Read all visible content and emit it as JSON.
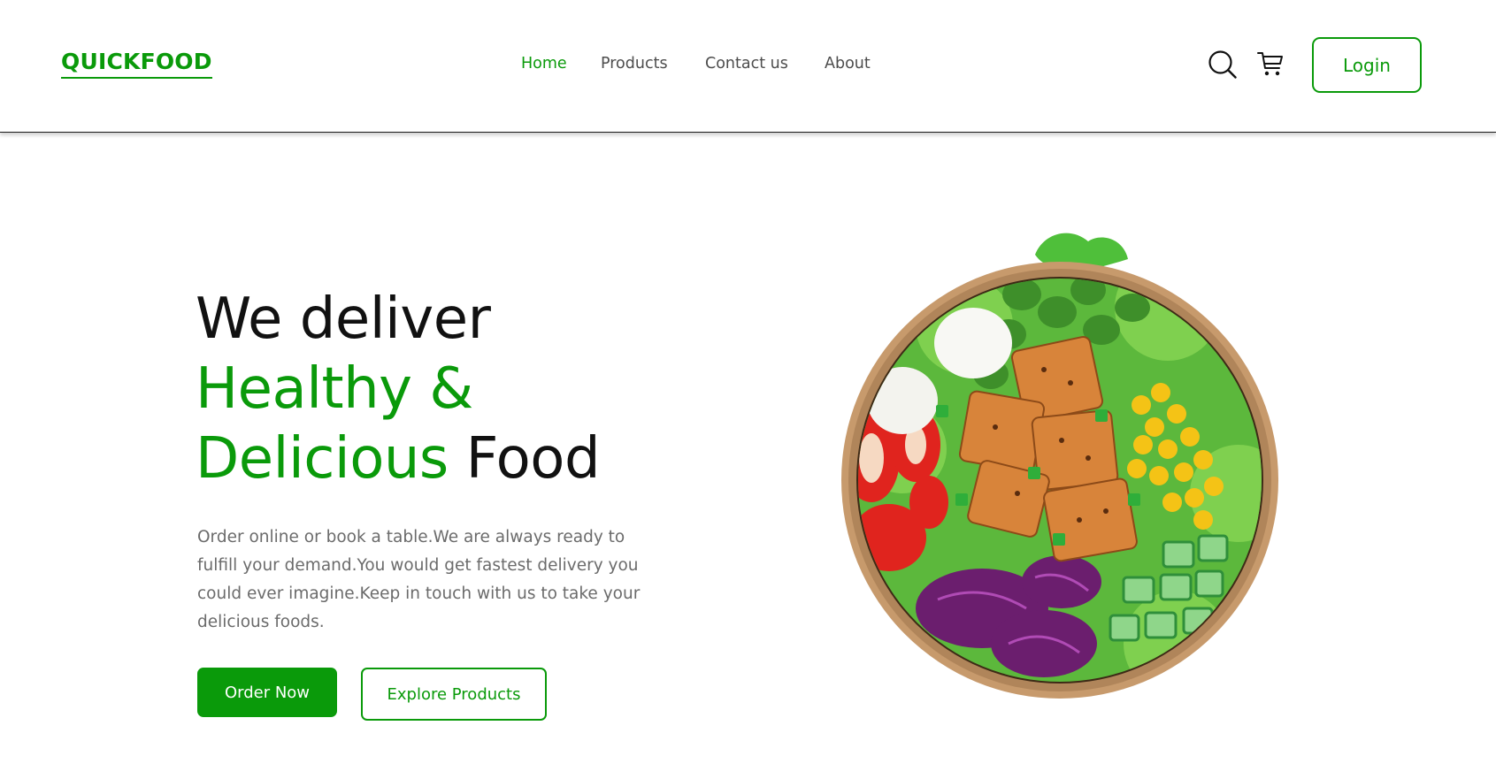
{
  "header": {
    "logo": "QUICKFOOD",
    "nav": [
      {
        "label": "Home",
        "active": true
      },
      {
        "label": "Products",
        "active": false
      },
      {
        "label": "Contact us",
        "active": false
      },
      {
        "label": "About",
        "active": false
      }
    ],
    "icons": [
      "search-icon",
      "cart-icon"
    ],
    "login_label": "Login"
  },
  "hero": {
    "title_line1": "We deliver",
    "title_line2": "Healthy &",
    "title_line3_green": "Delicious",
    "title_line3_rest": " Food",
    "description": "Order online or book a table.We are always ready to fulfill your demand.You would get fastest delivery you could ever imagine.Keep in touch with us to take your delicious foods.",
    "order_label": "Order Now",
    "explore_label": "Explore Products"
  },
  "colors": {
    "brand": "#0a9a0a",
    "text": "#111111",
    "muted": "#6b6b6b"
  }
}
